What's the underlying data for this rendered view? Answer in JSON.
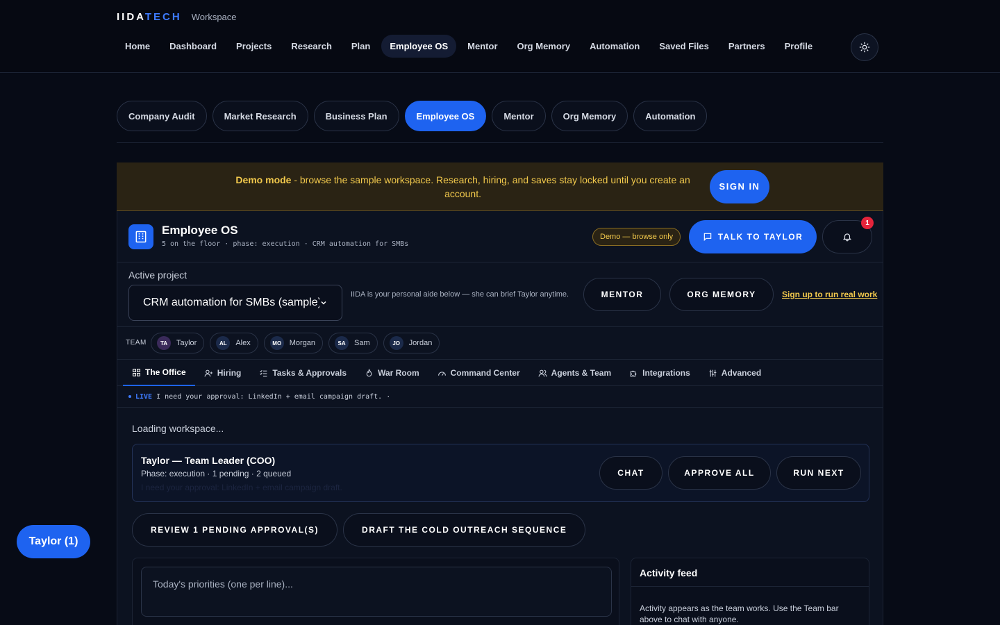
{
  "brand": {
    "logo_a": "IIDA",
    "logo_b": "TECH",
    "subtitle": "Workspace"
  },
  "nav": {
    "items": [
      "Home",
      "Dashboard",
      "Projects",
      "Research",
      "Plan",
      "Employee OS",
      "Mentor",
      "Org Memory",
      "Automation",
      "Saved Files",
      "Partners",
      "Profile"
    ],
    "active": "Employee OS"
  },
  "subtabs": {
    "items": [
      "Company Audit",
      "Market Research",
      "Business Plan",
      "Employee OS",
      "Mentor",
      "Org Memory",
      "Automation"
    ],
    "active": "Employee OS"
  },
  "demo_banner": {
    "bold": "Demo mode",
    "text": " - browse the sample workspace. Research, hiring, and saves stay locked until you create an account.",
    "sign_in": "SIGN IN"
  },
  "employee_os": {
    "title": "Employee OS",
    "subtitle": "5 on the floor · phase: execution · CRM automation for SMBs",
    "demo_badge": "Demo — browse only",
    "talk_button": "TALK TO TAYLOR",
    "notification_count": "1"
  },
  "active_project": {
    "label": "Active project",
    "selected": "CRM automation for SMBs (sample)",
    "hint": "IIDA is your personal aide below — she can brief Taylor anytime.",
    "mentor_button": "MENTOR",
    "org_memory_button": "ORG MEMORY",
    "signup_link": "Sign up to run real work"
  },
  "team": {
    "label": "TEAM",
    "members": [
      {
        "initials": "TA",
        "name": "Taylor"
      },
      {
        "initials": "AL",
        "name": "Alex"
      },
      {
        "initials": "MO",
        "name": "Morgan"
      },
      {
        "initials": "SA",
        "name": "Sam"
      },
      {
        "initials": "JO",
        "name": "Jordan"
      }
    ]
  },
  "tabs": {
    "items": [
      {
        "label": "The Office",
        "icon": "grid-icon"
      },
      {
        "label": "Hiring",
        "icon": "user-plus-icon"
      },
      {
        "label": "Tasks & Approvals",
        "icon": "checklist-icon"
      },
      {
        "label": "War Room",
        "icon": "flame-icon"
      },
      {
        "label": "Command Center",
        "icon": "gauge-icon"
      },
      {
        "label": "Agents & Team",
        "icon": "users-icon"
      },
      {
        "label": "Integrations",
        "icon": "puzzle-icon"
      },
      {
        "label": "Advanced",
        "icon": "sliders-icon"
      }
    ],
    "active": "The Office"
  },
  "live": {
    "tag": "LIVE",
    "message": "I need your approval: LinkedIn + email campaign draft.",
    "trail": "·"
  },
  "office": {
    "loading": "Loading workspace...",
    "leader_title": "Taylor — Team Leader (COO)",
    "leader_sub": "Phase: execution · 1 pending · 2 queued",
    "leader_ghost": "I need your approval: LinkedIn + email campaign draft.",
    "chat_button": "CHAT",
    "approve_all_button": "APPROVE ALL",
    "run_next_button": "RUN NEXT",
    "review_button": "REVIEW 1 PENDING APPROVAL(S)",
    "draft_button": "DRAFT THE COLD OUTREACH SEQUENCE",
    "priorities_placeholder": "Today's priorities (one per line)...",
    "activity_title": "Activity feed",
    "activity_text": "Activity appears as the team works. Use the Team bar above to chat with anyone."
  },
  "fab": {
    "label": "Taylor (1)"
  },
  "colors": {
    "accent": "#1e63f0",
    "warning": "#f2c94c",
    "background": "#070b16",
    "alert": "#e5243b"
  }
}
